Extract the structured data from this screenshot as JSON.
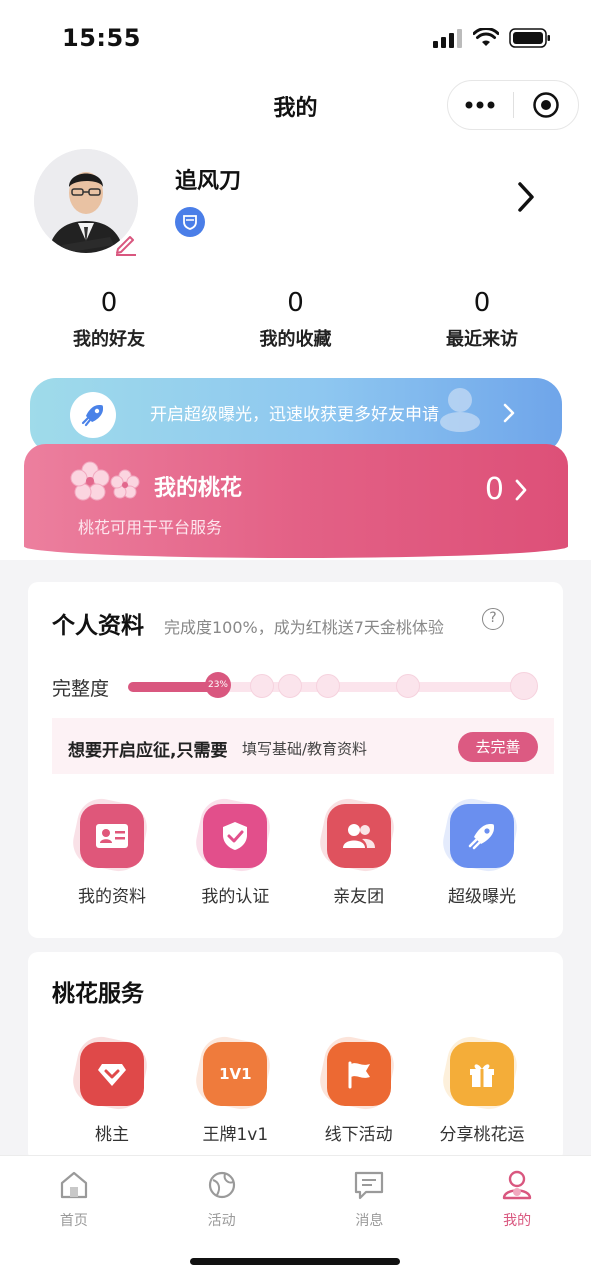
{
  "status_bar": {
    "time": "15:55"
  },
  "nav": {
    "title": "我的"
  },
  "profile": {
    "name": "追风刀"
  },
  "stats": [
    {
      "value": "0",
      "label": "我的好友"
    },
    {
      "value": "0",
      "label": "我的收藏"
    },
    {
      "value": "0",
      "label": "最近来访"
    }
  ],
  "promo": {
    "text": "开启超级曝光，迅速收获更多好友申请"
  },
  "peach": {
    "title": "我的桃花",
    "subtitle": "桃花可用于平台服务",
    "count": "0"
  },
  "info_card": {
    "title": "个人资料",
    "subtitle": "完成度100%，成为红桃送7天金桃体验",
    "help": "?",
    "progress_label": "完整度",
    "progress_percent_text": "23%",
    "progress_fraction": 0.23,
    "tip_strong": "想要开启应征,只需要",
    "tip_normal": "填写基础/教育资料",
    "tip_button": "去完善",
    "items": [
      {
        "label": "我的资料",
        "icon": "id-card-icon",
        "color": "#e0577a"
      },
      {
        "label": "我的认证",
        "icon": "shield-check-icon",
        "color": "#e2508c"
      },
      {
        "label": "亲友团",
        "icon": "people-icon",
        "color": "#e0525e"
      },
      {
        "label": "超级曝光",
        "icon": "rocket-icon",
        "color": "#6b8ff0"
      }
    ]
  },
  "service_card": {
    "title": "桃花服务",
    "items": [
      {
        "label": "桃主",
        "icon": "heart-badge-icon",
        "color": "#e04a4a",
        "glyph": ""
      },
      {
        "label": "王牌1v1",
        "icon": "one-v-one-icon",
        "color": "#ef7c3c",
        "glyph": "1V1"
      },
      {
        "label": "线下活动",
        "icon": "flag-icon",
        "color": "#ec6a34",
        "glyph": ""
      },
      {
        "label": "分享桃花运",
        "icon": "gift-icon",
        "color": "#f4ae3a",
        "glyph": ""
      }
    ]
  },
  "tabbar": [
    {
      "label": "首页",
      "icon": "home-icon",
      "active": false
    },
    {
      "label": "活动",
      "icon": "globe-icon",
      "active": false
    },
    {
      "label": "消息",
      "icon": "message-icon",
      "active": false
    },
    {
      "label": "我的",
      "icon": "user-icon",
      "active": true
    }
  ],
  "colors": {
    "brand_pink": "#d9577f",
    "promo_blue": "#6fa5ea"
  }
}
